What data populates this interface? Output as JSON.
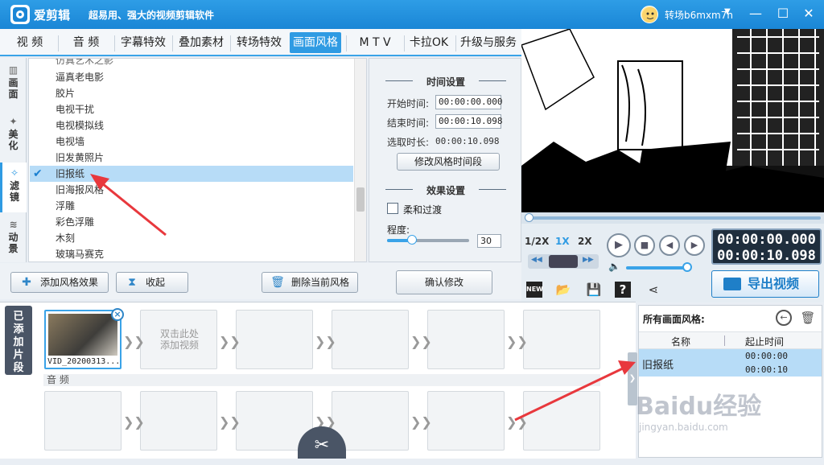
{
  "window": {
    "app_name": "爱剪辑",
    "slogan": "超易用、强大的视频剪辑软件",
    "user_name": "转场b6mxm7n",
    "dropdown_glyph": "▼",
    "minimize_glyph": "—",
    "maximize_glyph": "☐",
    "close_glyph": "✕"
  },
  "tabs": [
    {
      "label": "视 频"
    },
    {
      "label": "音 频"
    },
    {
      "label": "字幕特效"
    },
    {
      "label": "叠加素材"
    },
    {
      "label": "转场特效"
    },
    {
      "label": "画面风格",
      "active": true
    },
    {
      "label": "M T V"
    },
    {
      "label": "卡拉OK"
    },
    {
      "label": "升级与服务"
    }
  ],
  "leftnav": [
    {
      "label": "画面",
      "icon": "film-strip-icon"
    },
    {
      "label": "美化",
      "icon": "magic-wand-icon"
    },
    {
      "label": "滤镜",
      "icon": "filter-wand-icon",
      "active": true
    },
    {
      "label": "动景",
      "icon": "wave-icon"
    }
  ],
  "style_list": {
    "category_partial": "仿真艺术之影",
    "items": [
      {
        "label": "逼真老电影"
      },
      {
        "label": "胶片"
      },
      {
        "label": "电视干扰"
      },
      {
        "label": "电视模拟线"
      },
      {
        "label": "电视墙"
      },
      {
        "label": "旧发黄照片"
      },
      {
        "label": "旧报纸",
        "selected": true
      },
      {
        "label": "旧海报风格"
      },
      {
        "label": "浮雕"
      },
      {
        "label": "彩色浮雕"
      },
      {
        "label": "木刻"
      },
      {
        "label": "玻璃马赛克"
      }
    ],
    "check_glyph": "✔"
  },
  "settings": {
    "time_title": "时间设置",
    "start_label": "开始时间:",
    "start_value": "00:00:00.000",
    "end_label": "结束时间:",
    "end_value": "00:00:10.098",
    "duration_label": "选取时长:",
    "duration_value": "00:00:10.098",
    "modify_time_btn": "修改风格时间段",
    "effect_title": "效果设置",
    "smooth_label": "柔和过渡",
    "degree_label": "程度:",
    "degree_value": "30",
    "degree_fraction": 0.3,
    "confirm_btn": "确认修改"
  },
  "actions": {
    "add_style": "添加风格效果",
    "collapse": "收起",
    "delete_style": "删除当前风格"
  },
  "player": {
    "speed_half": "1/2X",
    "speed_1x": "1X",
    "speed_2x": "2X",
    "timecode_current": "00:00:00.000",
    "timecode_total": "00:00:10.098",
    "progress": 0.0,
    "volume": 0.95,
    "export_label": "导出视频",
    "play_glyph": "▶",
    "stop_glyph": "■",
    "prev_glyph": "◀",
    "next_glyph": "▶",
    "rew_glyph": "◀◀",
    "ff_glyph": "▶▶",
    "volume_glyph": "🔈",
    "tools": {
      "new": "NEW",
      "open": "📂",
      "save": "💾",
      "help": "?",
      "share": "⋖"
    }
  },
  "timeline": {
    "side_label": "已添加片段",
    "clip_name": "VID_20200313...",
    "empty_hint_line1": "双击此处",
    "empty_hint_line2": "添加视频",
    "audio_label": "音 频",
    "close_glyph": "×",
    "chevron_glyph": "❯❯",
    "scissors_glyph": "✂",
    "collapse_glyph": "❯"
  },
  "right_panel": {
    "title": "所有画面风格:",
    "col_name": "名称",
    "col_time": "起止时间",
    "row_name": "旧报纸",
    "row_start": "00:00:00",
    "row_end": "00:00:10",
    "back_glyph": "←",
    "delete_glyph": "🗑"
  },
  "watermark": {
    "main": "Baidu经验",
    "sub": "jingyan.baidu.com"
  },
  "colors": {
    "accent": "#2f9be3",
    "title_bar": "#1a86d6",
    "selection": "#b7dcf7",
    "annotation": "#e8383d"
  }
}
